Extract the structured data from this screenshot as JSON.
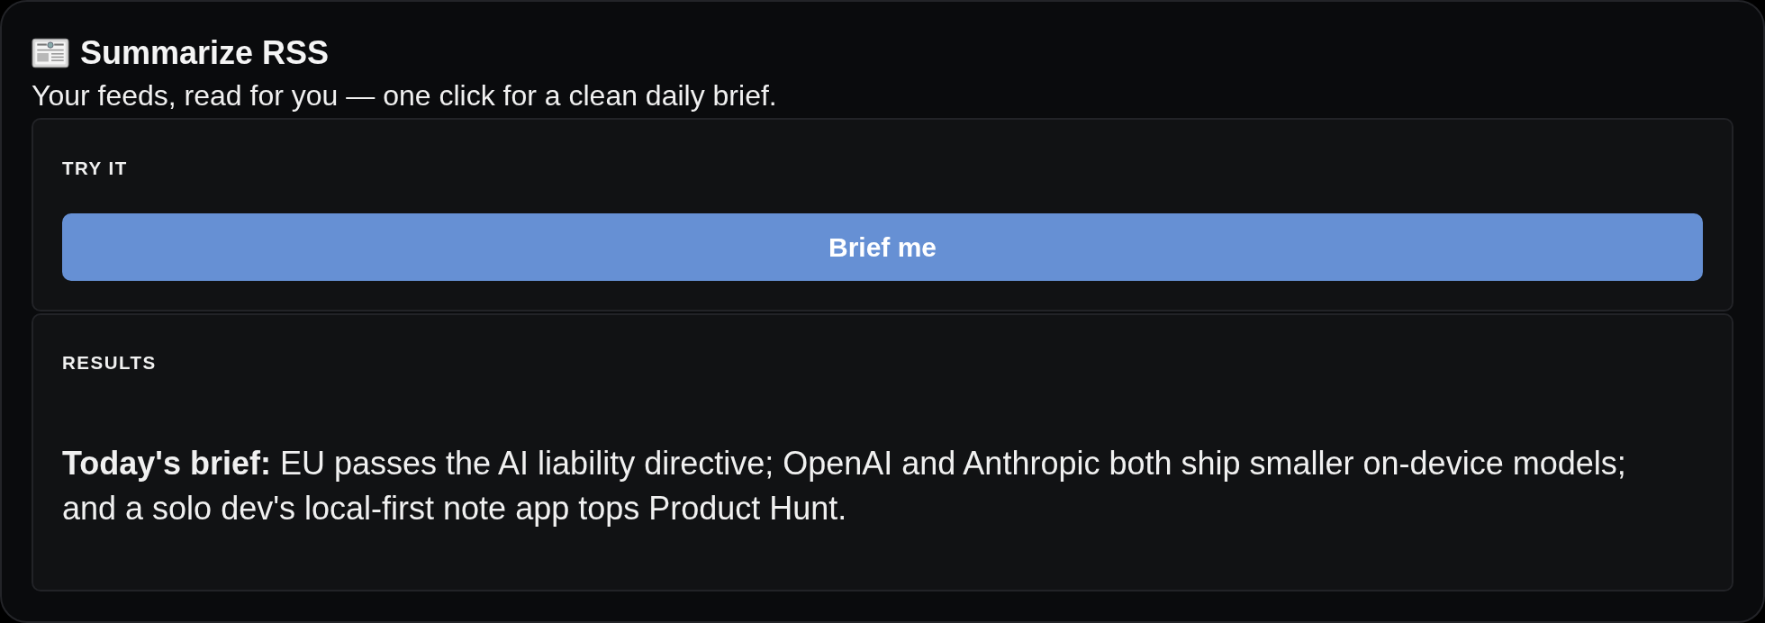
{
  "header": {
    "title": "Summarize RSS",
    "tagline": "Your feeds, read for you — one click for a clean daily brief."
  },
  "sections": [
    {
      "kind": "action",
      "label": "TRY IT",
      "button": "Brief me"
    },
    {
      "kind": "results",
      "label": "RESULTS",
      "text": "**Today's brief:** EU passes the AI liability directive; OpenAI and Anthropic both ship smaller on-device models; and a solo dev's local-first note app tops Product Hunt."
    }
  ]
}
